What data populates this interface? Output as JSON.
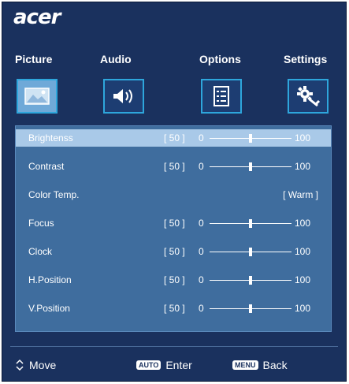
{
  "brand": {
    "logo": "acer"
  },
  "tabs": [
    {
      "label": "Picture",
      "icon": "picture-icon",
      "active": true
    },
    {
      "label": "Audio",
      "icon": "speaker-icon",
      "active": false
    },
    {
      "label": "Options",
      "icon": "document-icon",
      "active": false
    },
    {
      "label": "Settings",
      "icon": "gear-wrench-icon",
      "active": false
    }
  ],
  "settings": [
    {
      "label": "Brightenss",
      "value": "[ 50 ]",
      "min": "0",
      "max": "100",
      "level": 50,
      "highlight": true
    },
    {
      "label": "Contrast",
      "value": "[ 50 ]",
      "min": "0",
      "max": "100",
      "level": 50,
      "highlight": false
    },
    {
      "label": "Color Temp.",
      "option": "[ Warm ]",
      "highlight": false
    },
    {
      "label": "Focus",
      "value": "[ 50 ]",
      "min": "0",
      "max": "100",
      "level": 50,
      "highlight": false
    },
    {
      "label": "Clock",
      "value": "[ 50 ]",
      "min": "0",
      "max": "100",
      "level": 50,
      "highlight": false
    },
    {
      "label": "H.Position",
      "value": "[ 50 ]",
      "min": "0",
      "max": "100",
      "level": 50,
      "highlight": false
    },
    {
      "label": "V.Position",
      "value": "[ 50 ]",
      "min": "0",
      "max": "100",
      "level": 50,
      "highlight": false
    }
  ],
  "footer": {
    "move_label": "Move",
    "enter_key": "AUTO",
    "enter_label": "Enter",
    "back_key": "MENU",
    "back_label": "Back"
  },
  "colors": {
    "background": "#1a315e",
    "panel": "#3f6d9e",
    "highlight_row": "#a9c9e8",
    "tab_border": "#2ea6dc"
  }
}
